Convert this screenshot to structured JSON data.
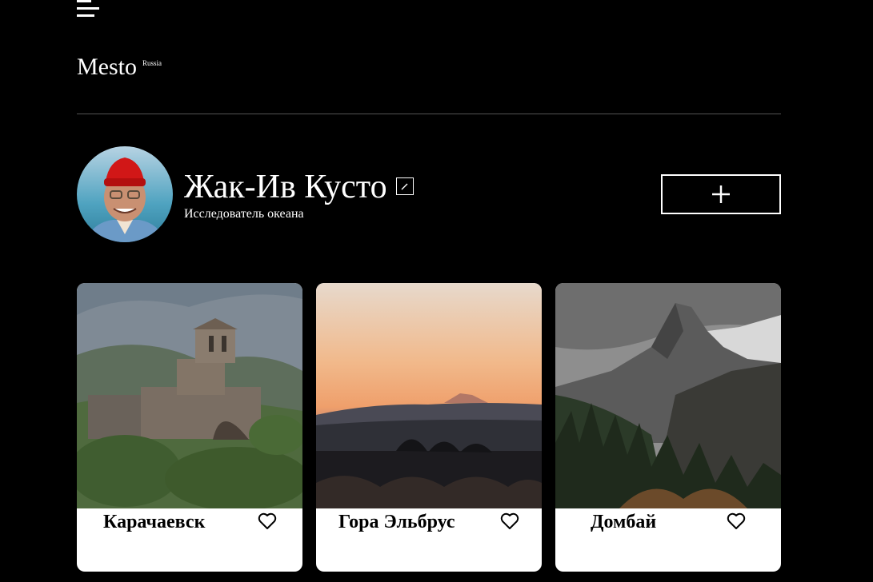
{
  "header": {
    "logo_text": "Mesto",
    "logo_superscript": "Russia",
    "menu_icon": "hamburger-menu-icon"
  },
  "profile": {
    "name": "Жак-Ив Кусто",
    "about": "Исследователь океана",
    "edit_icon": "pencil-icon",
    "add_icon": "plus-icon"
  },
  "cards": [
    {
      "title": "Карачаевск",
      "like_icon": "heart-outline-icon"
    },
    {
      "title": "Гора Эльбрус",
      "like_icon": "heart-outline-icon"
    },
    {
      "title": "Домбай",
      "like_icon": "heart-outline-icon"
    }
  ],
  "colors": {
    "background": "#000000",
    "text": "#ffffff",
    "card_background": "#ffffff",
    "card_text": "#000000",
    "divider": "#545454"
  }
}
